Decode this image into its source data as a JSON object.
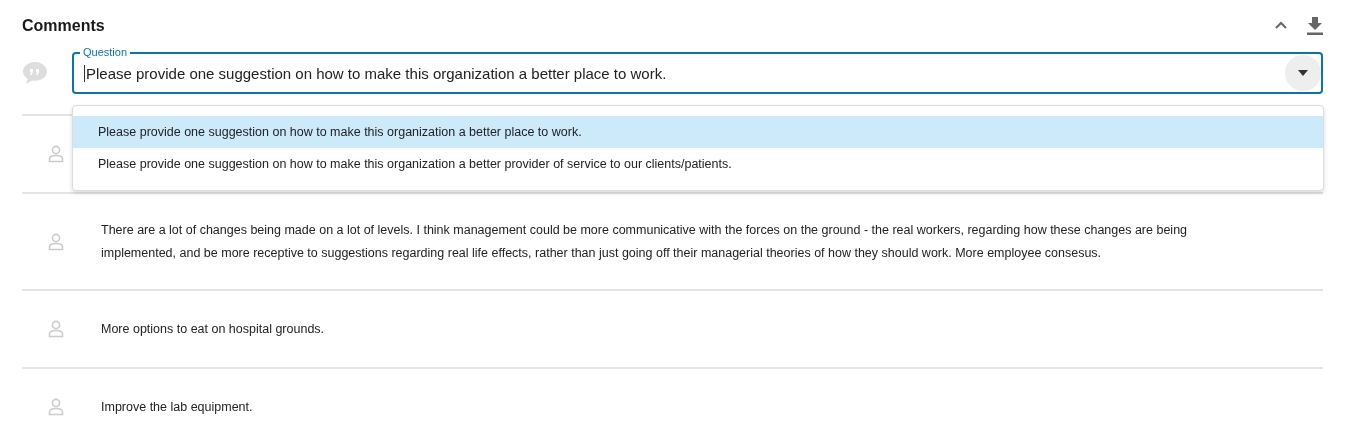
{
  "section": {
    "title": "Comments"
  },
  "question": {
    "label": "Question",
    "value": "Please provide one suggestion on how to make this organization a better place to work.",
    "expanded": true,
    "options": [
      {
        "label": "Please provide one suggestion on how to make this organization a better place to work.",
        "selected": true
      },
      {
        "label": "Please provide one suggestion on how to make this organization a better provider of service to our clients/patients.",
        "selected": false
      }
    ]
  },
  "comments": [
    {
      "kind": "covered"
    },
    {
      "kind": "text",
      "text": "There are a lot of changes being made on a lot of levels. I think management could be more communicative with the forces on the ground - the real workers, regarding how these changes are being implemented, and be more receptive to suggestions regarding real life effects, rather than just going off their managerial theories of how they should work. More employee consesus."
    },
    {
      "kind": "text",
      "text": "More options to eat on hospital grounds."
    },
    {
      "kind": "text",
      "text": "Improve the lab equipment."
    }
  ]
}
